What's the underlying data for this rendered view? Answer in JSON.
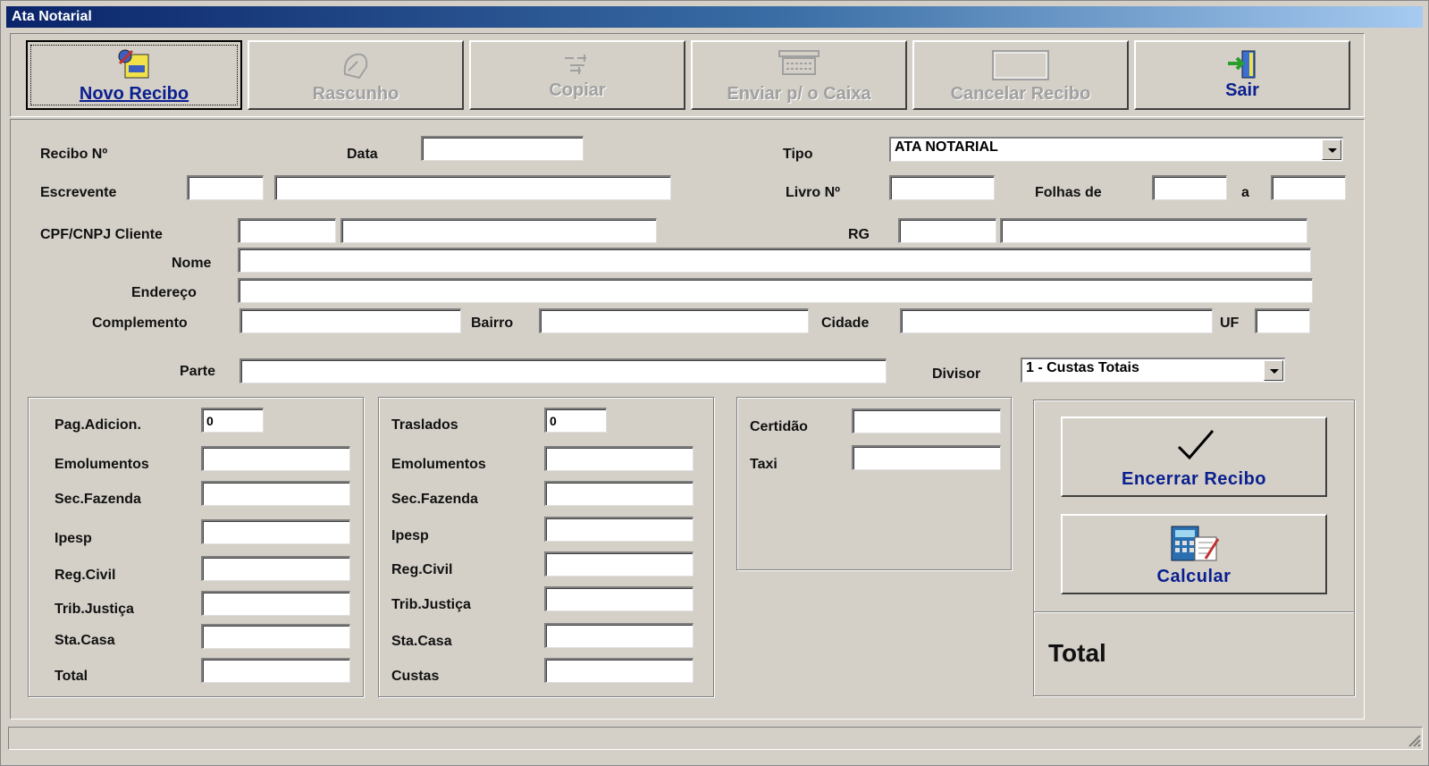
{
  "window": {
    "title": "Ata Notarial"
  },
  "toolbar": {
    "buttons": [
      {
        "label": "Novo Recibo"
      },
      {
        "label": "Rascunho"
      },
      {
        "label": "Copiar"
      },
      {
        "label": "Enviar p/ o Caixa"
      },
      {
        "label": "Cancelar Recibo"
      },
      {
        "label": "Sair"
      }
    ]
  },
  "form": {
    "recibo_label": "Recibo Nº",
    "data_label": "Data",
    "tipo_label": "Tipo",
    "tipo_value": "ATA NOTARIAL",
    "escrevente_label": "Escrevente",
    "livro_label": "Livro Nº",
    "folhas_label": "Folhas de",
    "a_label": "a",
    "cpf_label": "CPF/CNPJ Cliente",
    "rg_label": "RG",
    "nome_label": "Nome",
    "endereco_label": "Endereço",
    "complemento_label": "Complemento",
    "bairro_label": "Bairro",
    "cidade_label": "Cidade",
    "uf_label": "UF",
    "parte_label": "Parte",
    "divisor_label": "Divisor",
    "divisor_value": "1 - Custas Totais"
  },
  "left_group": {
    "pag_label": "Pag.Adicion.",
    "pag_value": "0",
    "rows": [
      "Emolumentos",
      "Sec.Fazenda",
      "Ipesp",
      "Reg.Civil",
      "Trib.Justiça",
      "Sta.Casa",
      "Total"
    ]
  },
  "mid_group": {
    "traslados_label": "Traslados",
    "traslados_value": "0",
    "rows": [
      "Emolumentos",
      "Sec.Fazenda",
      "Ipesp",
      "Reg.Civil",
      "Trib.Justiça",
      "Sta.Casa",
      "Custas"
    ]
  },
  "right_group": {
    "certidao_label": "Certidão",
    "taxi_label": "Taxi"
  },
  "actions": {
    "encerrar_label": "Encerrar Recibo",
    "calcular_label": "Calcular",
    "total_label": "Total"
  }
}
